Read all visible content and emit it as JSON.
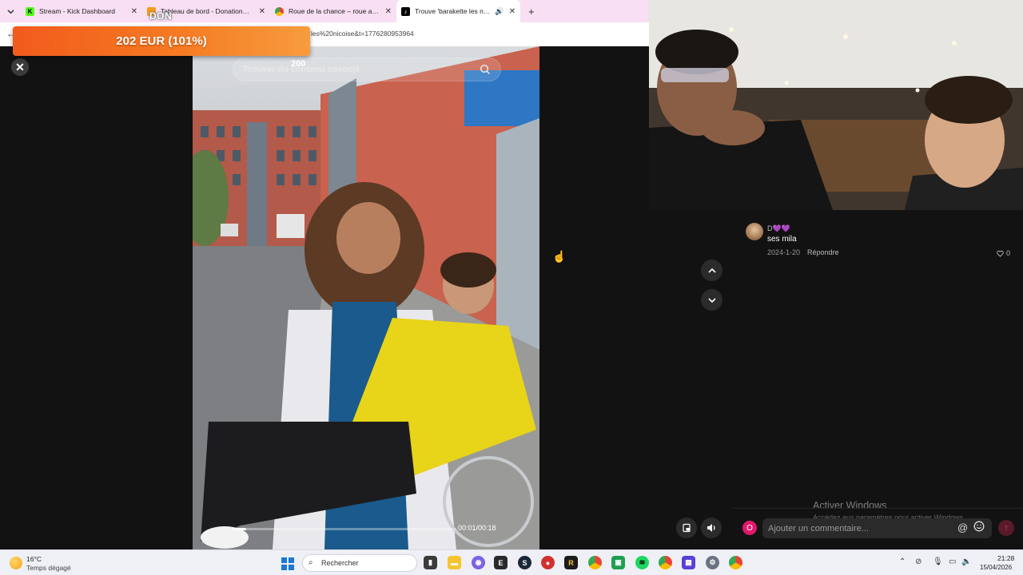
{
  "browser": {
    "tabs": [
      {
        "title": "Stream - Kick Dashboard",
        "favicon": "kick-icon",
        "color": "#53fc18",
        "active": false
      },
      {
        "title": "Tableau de bord - DonationAlerts",
        "favicon": "donationalerts-icon",
        "color": "#f59c1a",
        "active": false
      },
      {
        "title": "Roue de la chance – roue aléatoire",
        "favicon": "chrome-icon",
        "color": "#4285f4",
        "active": false
      },
      {
        "title": "Trouve 'barakette les nicoise'",
        "favicon": "tiktok-icon",
        "color": "#000000",
        "active": true
      }
    ],
    "url": "les%20nicoise&t=1776280953964"
  },
  "donation": {
    "label": "DON",
    "amount": "202 EUR (101%)",
    "goal": "200",
    "progress_percent": 101
  },
  "tiktok": {
    "search_placeholder": "Trouver du contenu associé",
    "video_time": "00:01/00:18",
    "video_progress": 0.06,
    "comment": {
      "username": "D💜💜",
      "text": "ses mila",
      "date": "2024-1-20",
      "reply_label": "Répondre",
      "likes": "0"
    },
    "comment_placeholder": "Ajouter un commentaire...",
    "user_initial": "O"
  },
  "watermark": {
    "line1": "Activer Windows",
    "line2": "Accédez aux paramètres pour activer Windows."
  },
  "taskbar": {
    "temp": "16°C",
    "weather": "Temps dégagé",
    "search_label": "Rechercher",
    "time": "21:28",
    "date": "15/04/2026"
  },
  "colors": {
    "accent": "#fe2c55",
    "donation_bar": "#f26a1f",
    "tab_bar": "#f8dff3"
  }
}
